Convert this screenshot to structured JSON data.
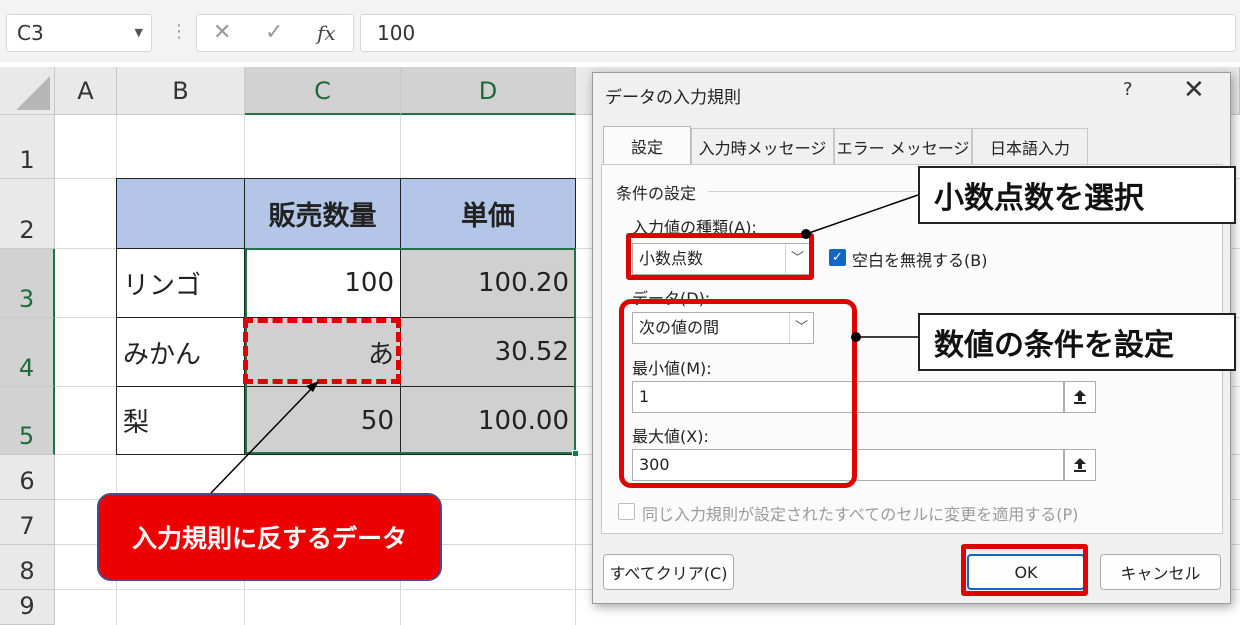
{
  "formula_bar": {
    "name_box": "C3",
    "cancel_icon": "✕",
    "enter_icon": "✓",
    "fx_label": "fx",
    "formula_value": "100"
  },
  "sheet": {
    "columns": [
      "A",
      "B",
      "C",
      "D"
    ],
    "rows": [
      "1",
      "2",
      "3",
      "4",
      "5",
      "6",
      "7",
      "8",
      "9"
    ],
    "table": {
      "headers": [
        "販売数量",
        "単価"
      ],
      "rows": [
        {
          "name": "リンゴ",
          "qty": "100",
          "price": "100.20"
        },
        {
          "name": "みかん",
          "qty": "あ",
          "price": "30.52"
        },
        {
          "name": "梨",
          "qty": "50",
          "price": "100.00"
        }
      ]
    }
  },
  "annotations": {
    "invalid_data_callout": "入力規則に反するデータ",
    "select_decimal_note": "小数点数を選択",
    "set_condition_note": "数値の条件を設定"
  },
  "dialog": {
    "title": "データの入力規則",
    "help_label": "?",
    "close_label": "✕",
    "tabs": [
      "設定",
      "入力時メッセージ",
      "エラー メッセージ",
      "日本語入力"
    ],
    "group_label": "条件の設定",
    "allow_label": "入力値の種類(A):",
    "allow_value": "小数点数",
    "ignore_blank_label": "空白を無視する(B)",
    "data_label": "データ(D):",
    "data_value": "次の値の間",
    "min_label": "最小値(M):",
    "min_value": "1",
    "max_label": "最大値(X):",
    "max_value": "300",
    "apply_all_label": "同じ入力規則が設定されたすべてのセルに変更を適用する(P)",
    "clear_all_button": "すべてクリア(C)",
    "ok_button": "OK",
    "cancel_button": "キャンセル"
  },
  "colors": {
    "header_fill": "#b4c6e7",
    "excel_green": "#217346",
    "annotation_red": "#e00000",
    "callout_fill": "#ee0000"
  }
}
